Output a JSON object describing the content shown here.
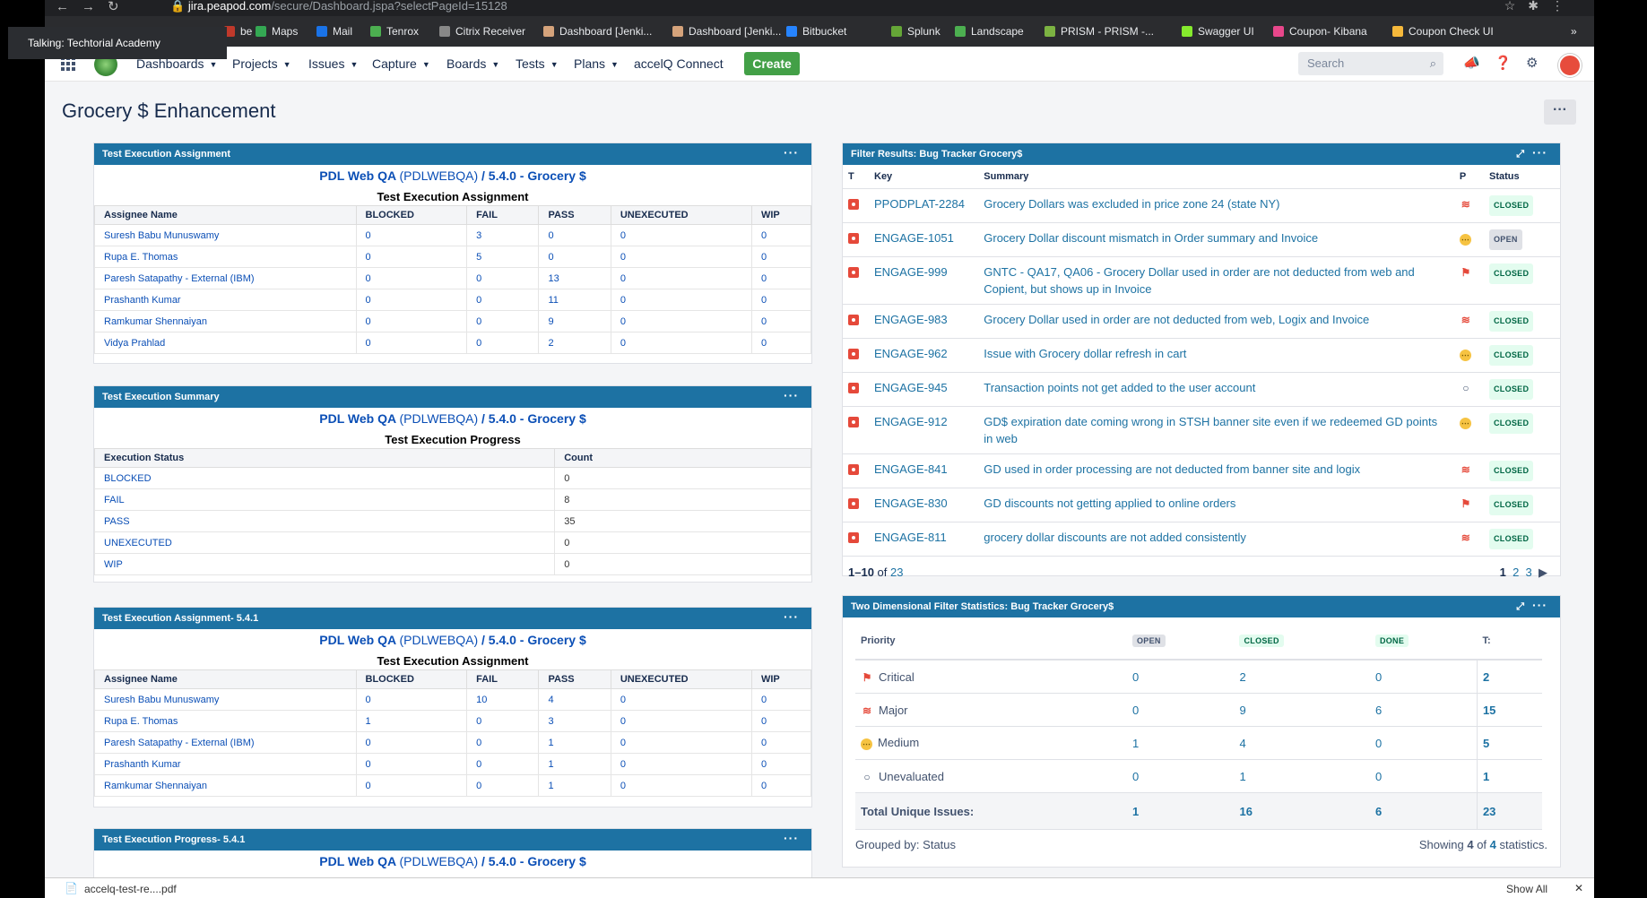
{
  "browser": {
    "url_host": "jira.peapod.com",
    "url_path": "/secure/Dashboard.jspa?selectPageId=15128",
    "bookmarks": [
      {
        "label": "be",
        "color": "#c0392b"
      },
      {
        "label": "Maps",
        "color": "#34a853"
      },
      {
        "label": "Mail",
        "color": "#1a73e8"
      },
      {
        "label": "Tenrox",
        "color": "#4caf50"
      },
      {
        "label": "Citrix Receiver",
        "color": "#888888"
      },
      {
        "label": "Dashboard [Jenki...",
        "color": "#d5a37b"
      },
      {
        "label": "Dashboard [Jenki...",
        "color": "#d5a37b"
      },
      {
        "label": "Bitbucket",
        "color": "#2684ff"
      },
      {
        "label": "Splunk",
        "color": "#65a637"
      },
      {
        "label": "Landscape",
        "color": "#4caf50"
      },
      {
        "label": "PRISM - PRISM -...",
        "color": "#7cb342"
      },
      {
        "label": "Swagger UI",
        "color": "#85ea2d"
      },
      {
        "label": "Coupon- Kibana",
        "color": "#e8478b"
      },
      {
        "label": "Coupon Check UI",
        "color": "#f6b93b"
      }
    ],
    "overflow": "»"
  },
  "tooltip": "Talking: Techtorial Academy",
  "header": {
    "menus": [
      "Dashboards",
      "Projects",
      "Issues",
      "Capture",
      "Boards",
      "Tests",
      "Plans"
    ],
    "connect_label": "accelQ Connect",
    "create_label": "Create",
    "search_placeholder": "Search"
  },
  "page_title": "Grocery $ Enhancement",
  "more_label": "···",
  "project": {
    "name": "PDL Web QA",
    "key": "(PDLWEBQA)",
    "sep": " / ",
    "version": "5.4.0 - Grocery $"
  },
  "gadget1": {
    "title": "Test Execution Assignment",
    "subtitle": "Test Execution Assignment",
    "columns": [
      "Assignee Name",
      "BLOCKED",
      "FAIL",
      "PASS",
      "UNEXECUTED",
      "WIP"
    ],
    "rows": [
      [
        "Suresh Babu Munuswamy",
        "0",
        "3",
        "0",
        "0",
        "0"
      ],
      [
        "Rupa E. Thomas",
        "0",
        "5",
        "0",
        "0",
        "0"
      ],
      [
        "Paresh Satapathy - External (IBM)",
        "0",
        "0",
        "13",
        "0",
        "0"
      ],
      [
        "Prashanth Kumar",
        "0",
        "0",
        "11",
        "0",
        "0"
      ],
      [
        "Ramkumar Shennaiyan",
        "0",
        "0",
        "9",
        "0",
        "0"
      ],
      [
        "Vidya Prahlad",
        "0",
        "0",
        "2",
        "0",
        "0"
      ]
    ]
  },
  "gadget2": {
    "title": "Test Execution Summary",
    "subtitle": "Test Execution Progress",
    "columns": [
      "Execution Status",
      "Count"
    ],
    "rows": [
      [
        "BLOCKED",
        "0"
      ],
      [
        "FAIL",
        "8"
      ],
      [
        "PASS",
        "35"
      ],
      [
        "UNEXECUTED",
        "0"
      ],
      [
        "WIP",
        "0"
      ]
    ]
  },
  "gadget3": {
    "title": "Test Execution Assignment- 5.4.1",
    "subtitle": "Test Execution Assignment",
    "columns": [
      "Assignee Name",
      "BLOCKED",
      "FAIL",
      "PASS",
      "UNEXECUTED",
      "WIP"
    ],
    "rows": [
      [
        "Suresh Babu Munuswamy",
        "0",
        "10",
        "4",
        "0",
        "0"
      ],
      [
        "Rupa E. Thomas",
        "1",
        "0",
        "3",
        "0",
        "0"
      ],
      [
        "Paresh Satapathy - External (IBM)",
        "0",
        "0",
        "1",
        "0",
        "0"
      ],
      [
        "Prashanth Kumar",
        "0",
        "0",
        "1",
        "0",
        "0"
      ],
      [
        "Ramkumar Shennaiyan",
        "0",
        "0",
        "1",
        "0",
        "0"
      ]
    ]
  },
  "gadget4": {
    "title": "Test Execution Progress- 5.4.1"
  },
  "filter": {
    "title": "Filter Results: Bug Tracker Grocery$",
    "columns": [
      "T",
      "Key",
      "Summary",
      "P",
      "Status"
    ],
    "rows": [
      {
        "key": "PPODPLAT-2284",
        "summary": "Grocery Dollars was excluded in price zone 24 (state NY)",
        "priority": "major",
        "status": "CLOSED"
      },
      {
        "key": "ENGAGE-1051",
        "summary": "Grocery Dollar discount mismatch in Order summary and Invoice",
        "priority": "medium",
        "status": "OPEN"
      },
      {
        "key": "ENGAGE-999",
        "summary": "GNTC - QA17, QA06 - Grocery Dollar used in order are not deducted from web and Copient, but shows up in Invoice",
        "priority": "critical",
        "status": "CLOSED"
      },
      {
        "key": "ENGAGE-983",
        "summary": "Grocery Dollar used in order are not deducted from web, Logix and Invoice",
        "priority": "major",
        "status": "CLOSED"
      },
      {
        "key": "ENGAGE-962",
        "summary": "Issue with Grocery dollar refresh in cart",
        "priority": "medium",
        "status": "CLOSED"
      },
      {
        "key": "ENGAGE-945",
        "summary": "Transaction points not get added to the user account",
        "priority": "unevaluated",
        "status": "CLOSED"
      },
      {
        "key": "ENGAGE-912",
        "summary": "GD$ expiration date coming wrong in STSH banner site even if we redeemed GD points in web",
        "priority": "medium",
        "status": "CLOSED"
      },
      {
        "key": "ENGAGE-841",
        "summary": "GD used in order processing are not deducted from banner site and logix",
        "priority": "major",
        "status": "CLOSED"
      },
      {
        "key": "ENGAGE-830",
        "summary": "GD discounts not getting applied to online orders",
        "priority": "critical",
        "status": "CLOSED"
      },
      {
        "key": "ENGAGE-811",
        "summary": "grocery dollar discounts are not added consistently",
        "priority": "major",
        "status": "CLOSED"
      }
    ],
    "range": "1–10",
    "of": "of",
    "total": "23",
    "pages": [
      "1",
      "2",
      "3"
    ]
  },
  "stats": {
    "title": "Two Dimensional Filter Statistics: Bug Tracker Grocery$",
    "columns": [
      "Priority",
      "OPEN",
      "CLOSED",
      "DONE",
      "T:"
    ],
    "rows": [
      {
        "label": "Critical",
        "icon": "critical",
        "open": "0",
        "closed": "2",
        "done": "0",
        "total": "2"
      },
      {
        "label": "Major",
        "icon": "major",
        "open": "0",
        "closed": "9",
        "done": "6",
        "total": "15"
      },
      {
        "label": "Medium",
        "icon": "medium",
        "open": "1",
        "closed": "4",
        "done": "0",
        "total": "5"
      },
      {
        "label": "Unevaluated",
        "icon": "unevaluated",
        "open": "0",
        "closed": "1",
        "done": "0",
        "total": "1"
      }
    ],
    "total_row": {
      "label": "Total Unique Issues:",
      "open": "1",
      "closed": "16",
      "done": "6",
      "total": "23"
    },
    "grouped_by": "Grouped by: Status",
    "showing": "Showing",
    "showing_a": "4",
    "showing_of": "of",
    "showing_b": "4",
    "showing_tail": "statistics."
  },
  "downloads": {
    "file": "accelq-test-re....pdf",
    "show_all": "Show All",
    "close": "✕"
  },
  "colors": {
    "gadget_header": "#1d72a3",
    "link": "#0b4fb6",
    "create": "#43a047",
    "critical": "#e5493a",
    "medium": "#f6c342"
  }
}
